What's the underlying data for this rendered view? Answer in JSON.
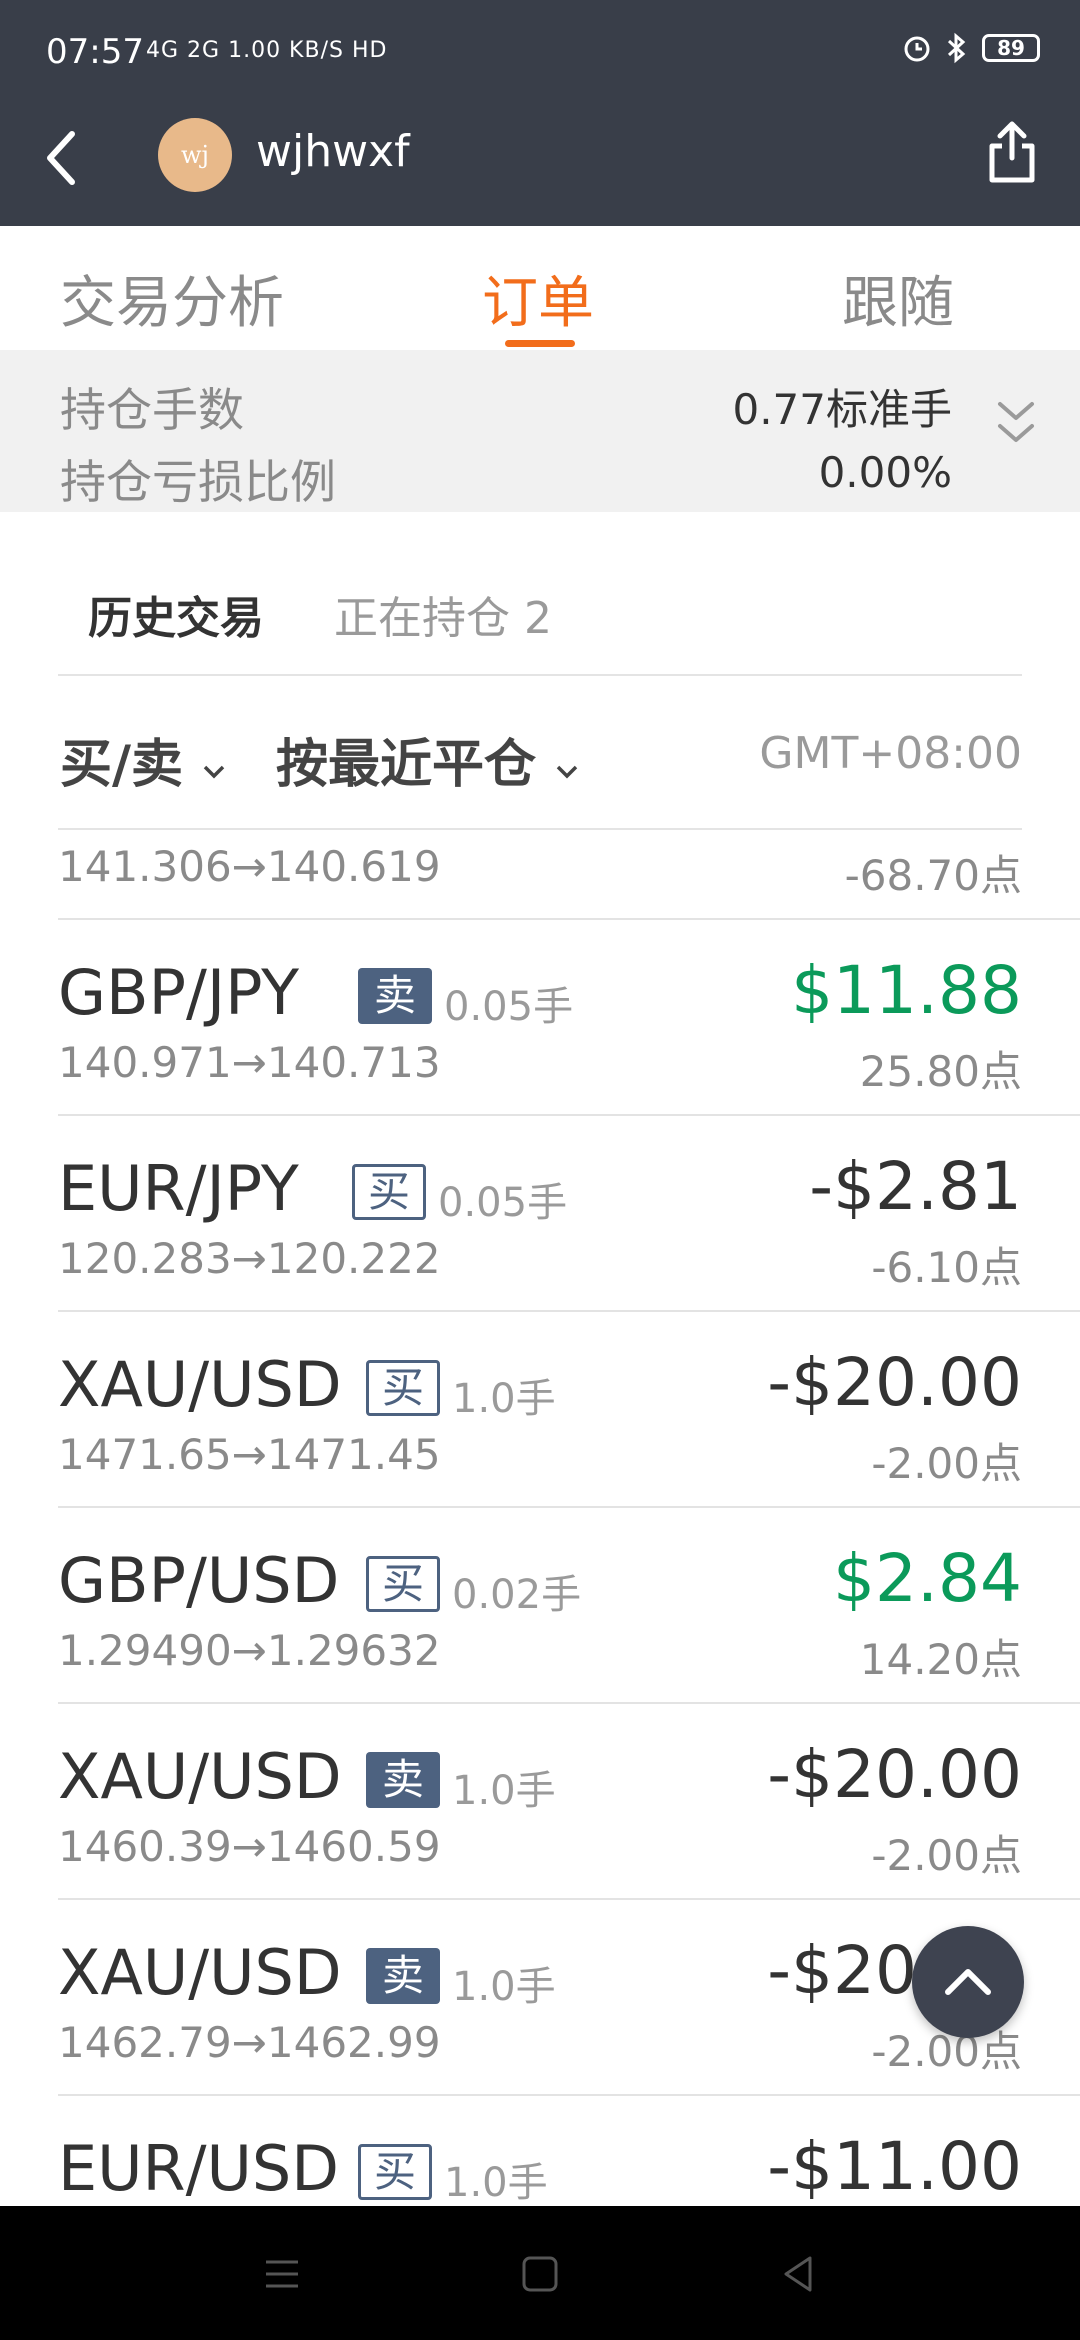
{
  "status_bar": {
    "time": "07:57",
    "network": "4G 2G 1.00 KB/S HD",
    "battery": "89"
  },
  "header": {
    "avatar_text": "wj",
    "username": "wjhwxf"
  },
  "tabs": [
    {
      "label": "交易分析",
      "active": false
    },
    {
      "label": "订单",
      "active": true
    },
    {
      "label": "跟随",
      "active": false
    }
  ],
  "summary": {
    "lots_label": "持仓手数",
    "lots_value": "0.77标准手",
    "loss_label": "持仓亏损比例",
    "loss_value": "0.00%"
  },
  "subtabs": {
    "history": "历史交易",
    "open": "正在持仓 2"
  },
  "filters": {
    "side": "买/卖",
    "sort": "按最近平仓",
    "timezone": "GMT+08:00"
  },
  "orders": [
    {
      "pair": "",
      "side": "",
      "side_type": "",
      "lots": "",
      "pnl": "",
      "pnl_type": "neg",
      "prices": "141.306→140.619",
      "points": "-68.70点"
    },
    {
      "pair": "GBP/JPY",
      "side": "卖",
      "side_type": "sell",
      "lots": "0.05手",
      "pnl": "$11.88",
      "pnl_type": "pos",
      "prices": "140.971→140.713",
      "points": "25.80点"
    },
    {
      "pair": "EUR/JPY",
      "side": "买",
      "side_type": "buy",
      "lots": "0.05手",
      "pnl": "-$2.81",
      "pnl_type": "neg",
      "prices": "120.283→120.222",
      "points": "-6.10点"
    },
    {
      "pair": "XAU/USD",
      "side": "买",
      "side_type": "buy",
      "lots": "1.0手",
      "pnl": "-$20.00",
      "pnl_type": "neg",
      "prices": "1471.65→1471.45",
      "points": "-2.00点"
    },
    {
      "pair": "GBP/USD",
      "side": "买",
      "side_type": "buy",
      "lots": "0.02手",
      "pnl": "$2.84",
      "pnl_type": "pos",
      "prices": "1.29490→1.29632",
      "points": "14.20点"
    },
    {
      "pair": "XAU/USD",
      "side": "卖",
      "side_type": "sell",
      "lots": "1.0手",
      "pnl": "-$20.00",
      "pnl_type": "neg",
      "prices": "1460.39→1460.59",
      "points": "-2.00点"
    },
    {
      "pair": "XAU/USD",
      "side": "卖",
      "side_type": "sell",
      "lots": "1.0手",
      "pnl": "-$20.00",
      "pnl_type": "neg",
      "prices": "1462.79→1462.99",
      "points": "-2.00点"
    },
    {
      "pair": "EUR/USD",
      "side": "买",
      "side_type": "buy",
      "lots": "1.0手",
      "pnl": "-$11.00",
      "pnl_type": "neg",
      "prices": "",
      "points": ""
    }
  ],
  "colors": {
    "accent": "#f26d1b",
    "header_bg": "#393e49",
    "profit": "#0b9a5a",
    "badge": "#4d6280"
  }
}
